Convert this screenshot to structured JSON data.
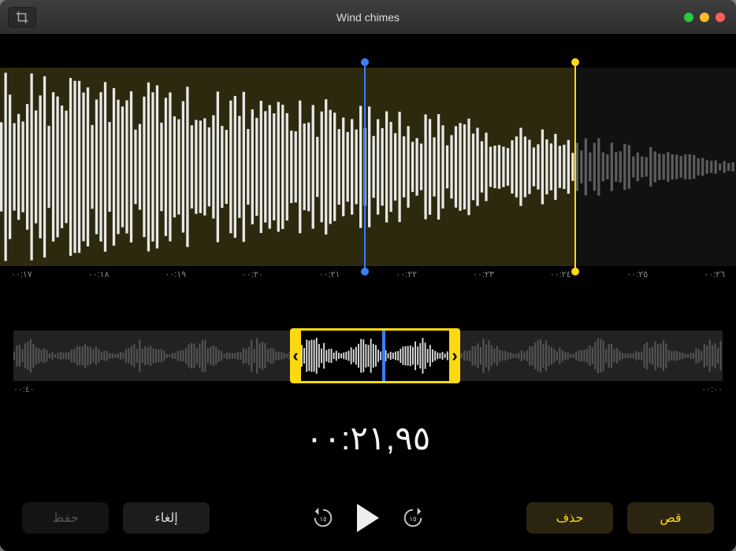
{
  "window": {
    "title": "Wind chimes"
  },
  "timeline": {
    "ticks": [
      "٠٠:١٧",
      "٠٠:١٨",
      "٠٠:١٩",
      "٠٠:٢٠",
      "٠٠:٢١",
      "٠٠:٢٢",
      "٠٠:٢٣",
      "٠٠:٢٤",
      "٠٠:٢٥",
      "٠٠:٢٦"
    ],
    "playhead_percent": 49.5,
    "selection_end_percent": 78
  },
  "overview": {
    "start_label": "٠٠:٠٠",
    "end_label": "٠٠:٤٠",
    "trim_start_percent": 39,
    "trim_end_percent": 63,
    "playhead_percent": 55
  },
  "current_time": "٠٠:٢١,٩٥",
  "buttons": {
    "save": "حفظ",
    "cancel": "إلغاء",
    "delete": "حذف",
    "cut": "قص"
  },
  "transport": {
    "skip_seconds": "١٥"
  },
  "colors": {
    "accent": "#ffd90f",
    "playhead": "#3a7fff"
  },
  "icons": {
    "trim": "crop-icon",
    "skip_back": "skip-back-15-icon",
    "skip_fwd": "skip-forward-15-icon",
    "play": "play-icon"
  }
}
